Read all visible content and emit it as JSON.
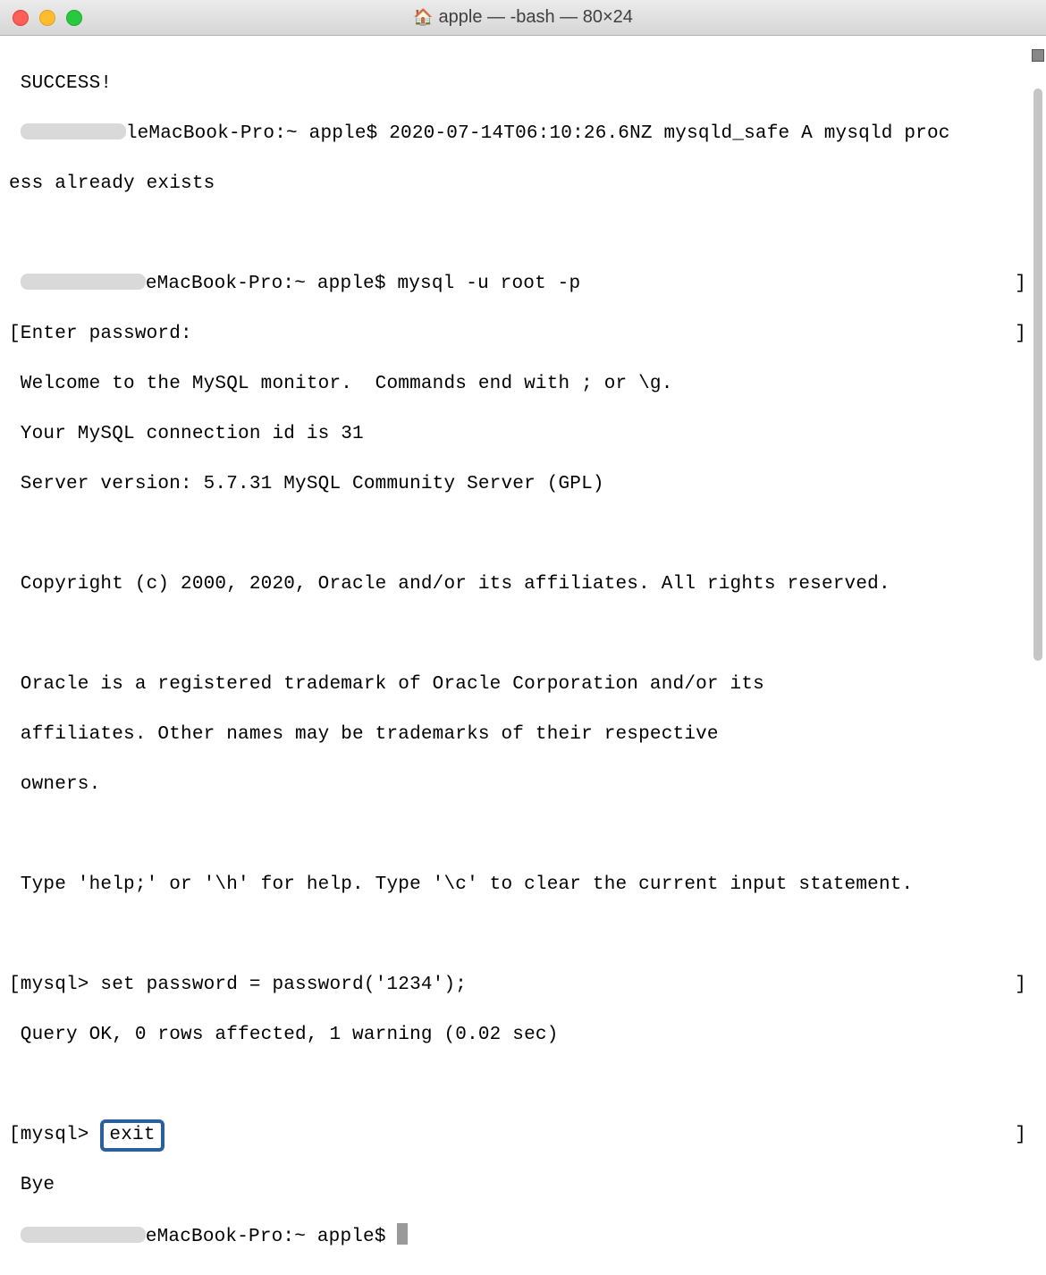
{
  "titlebar": {
    "title": "apple — -bash — 80×24",
    "homeIcon": "🏠"
  },
  "colors": {
    "close": "#ff5f57",
    "minimize": "#ffbd2e",
    "maximize": "#28c940",
    "highlightBorder": "#2a5f9e"
  },
  "lines": {
    "l1": " SUCCESS!",
    "l2a": "leMacBook-Pro:~ apple$ 2020-07-14T06:10:26.6NZ mysqld_safe A mysqld proc",
    "l3": "ess already exists",
    "l4": "",
    "l5a": "eMacBook-Pro:~ apple$ mysql -u root -p",
    "l5b": "]",
    "l6": "[Enter password: ",
    "l6b": "]",
    "l7": " Welcome to the MySQL monitor.  Commands end with ; or \\g.",
    "l8": " Your MySQL connection id is 31",
    "l9": " Server version: 5.7.31 MySQL Community Server (GPL)",
    "l10": "",
    "l11": " Copyright (c) 2000, 2020, Oracle and/or its affiliates. All rights reserved.",
    "l12": "",
    "l13": " Oracle is a registered trademark of Oracle Corporation and/or its",
    "l14": " affiliates. Other names may be trademarks of their respective",
    "l15": " owners.",
    "l16": "",
    "l17": " Type 'help;' or '\\h' for help. Type '\\c' to clear the current input statement.",
    "l18": "",
    "l19a": "[mysql> set password = password('1234');",
    "l19b": "]",
    "l20": " Query OK, 0 rows affected, 1 warning (0.02 sec)",
    "l21": "",
    "l22a": "[mysql> ",
    "l22b": "exit",
    "l22c": "]",
    "l23": " Bye",
    "l24a": "eMacBook-Pro:~ apple$ "
  }
}
